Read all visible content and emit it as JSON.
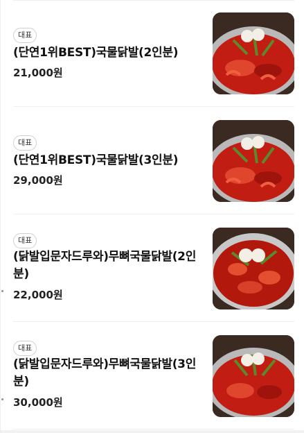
{
  "menu": {
    "items": [
      {
        "badge": "대표",
        "name": "(단연1위BEST)국물닭발(2인분)",
        "price": "21,000원"
      },
      {
        "badge": "대표",
        "name": "(단연1위BEST)국물닭발(3인분)",
        "price": "29,000원"
      },
      {
        "badge": "대표",
        "name": "(닭발입문자드루와)무뼈국물닭발(2인분)",
        "price": "22,000원"
      },
      {
        "badge": "대표",
        "name": "(닭발입문자드루와)무뼈국물닭발(3인분)",
        "price": "30,000원"
      }
    ]
  },
  "colors": {
    "accent": "#d22a1a",
    "divider": "#efefef",
    "badge_border": "#cfcfcf"
  }
}
